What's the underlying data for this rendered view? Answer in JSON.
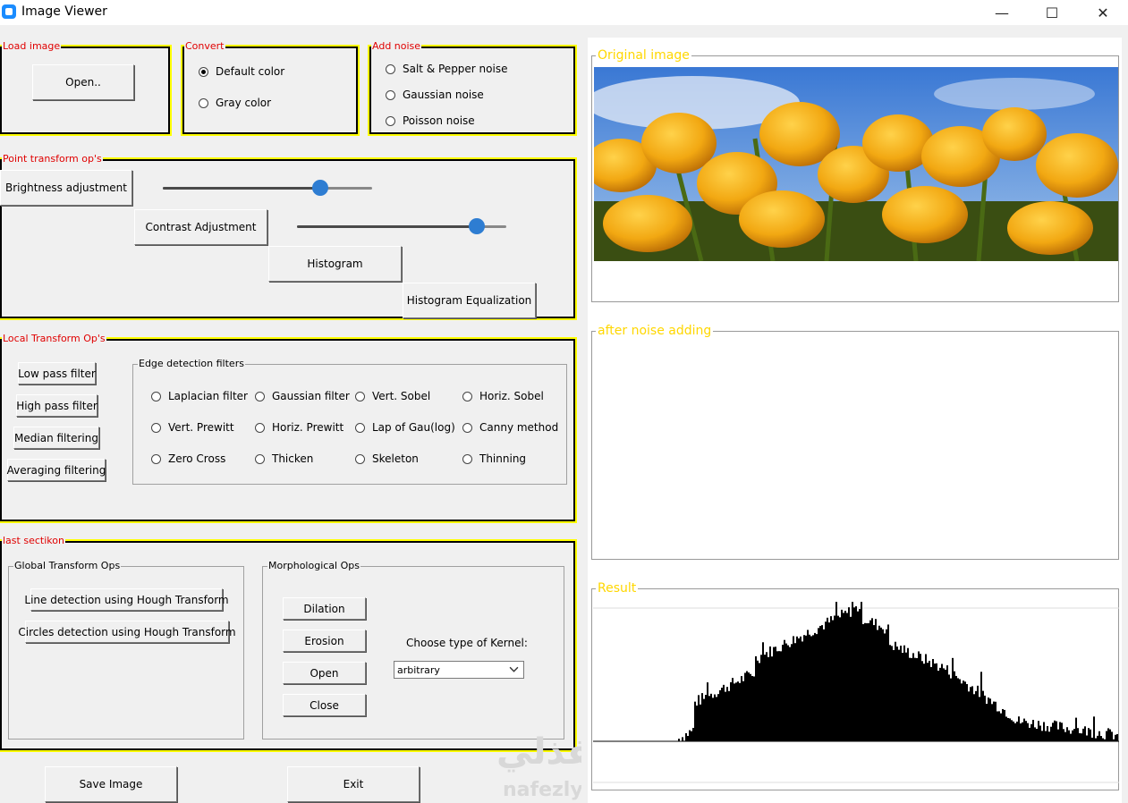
{
  "window": {
    "title": "Image Viewer",
    "minimize": "—",
    "maximize": "☐",
    "close": "✕"
  },
  "load": {
    "legend": "Load image",
    "open": "Open.."
  },
  "convert": {
    "legend": "Convert",
    "default_color": "Default color",
    "gray_color": "Gray color",
    "selected": "Default color"
  },
  "noise": {
    "legend": "Add noise",
    "salt": "Salt & Pepper noise",
    "gaussian": "Gaussian noise",
    "poisson": "Poisson noise"
  },
  "point": {
    "legend": "Point transform op's",
    "brightness": "Brightness adjustment",
    "contrast": "Contrast Adjustment",
    "histogram": "Histogram",
    "hist_eq": "Histogram Equalization",
    "brightness_value": 0.75,
    "contrast_value": 0.86
  },
  "local": {
    "legend": "Local Transform Op's",
    "low_pass": "Low pass filter",
    "high_pass": "High pass filter",
    "median": "Median filtering",
    "averaging": "Averaging filtering",
    "edge": {
      "legend": "Edge detection filters",
      "items": [
        "Laplacian filter",
        "Gaussian filter",
        "Vert. Sobel",
        "Horiz. Sobel",
        "Vert. Prewitt",
        "Horiz. Prewitt",
        "Lap of Gau(log)",
        "Canny method",
        "Zero Cross",
        "Thicken",
        "Skeleton",
        "Thinning"
      ]
    }
  },
  "last": {
    "legend": "last sectikon",
    "global": {
      "legend": "Global Transform Ops",
      "line": "Line detection using Hough Transform",
      "circles": "Circles detection using Hough Transform"
    },
    "morph": {
      "legend": "Morphological Ops",
      "dilation": "Dilation",
      "erosion": "Erosion",
      "open": "Open",
      "close": "Close",
      "kernel_label": "Choose type of Kernel:",
      "kernel_value": "arbitrary"
    }
  },
  "bottom": {
    "save": "Save Image",
    "exit": "Exit"
  },
  "panels": {
    "original": "Original image",
    "noise": "after noise adding",
    "result": "Result"
  },
  "watermark": {
    "arabic": "نفذلي",
    "latin": "nafezly.com"
  },
  "colors": {
    "frame_border": "#000000",
    "frame_glow": "#ffff00",
    "legend_red": "#e00000",
    "panel_legend": "#ffd700",
    "knob": "#2e7dd2"
  }
}
